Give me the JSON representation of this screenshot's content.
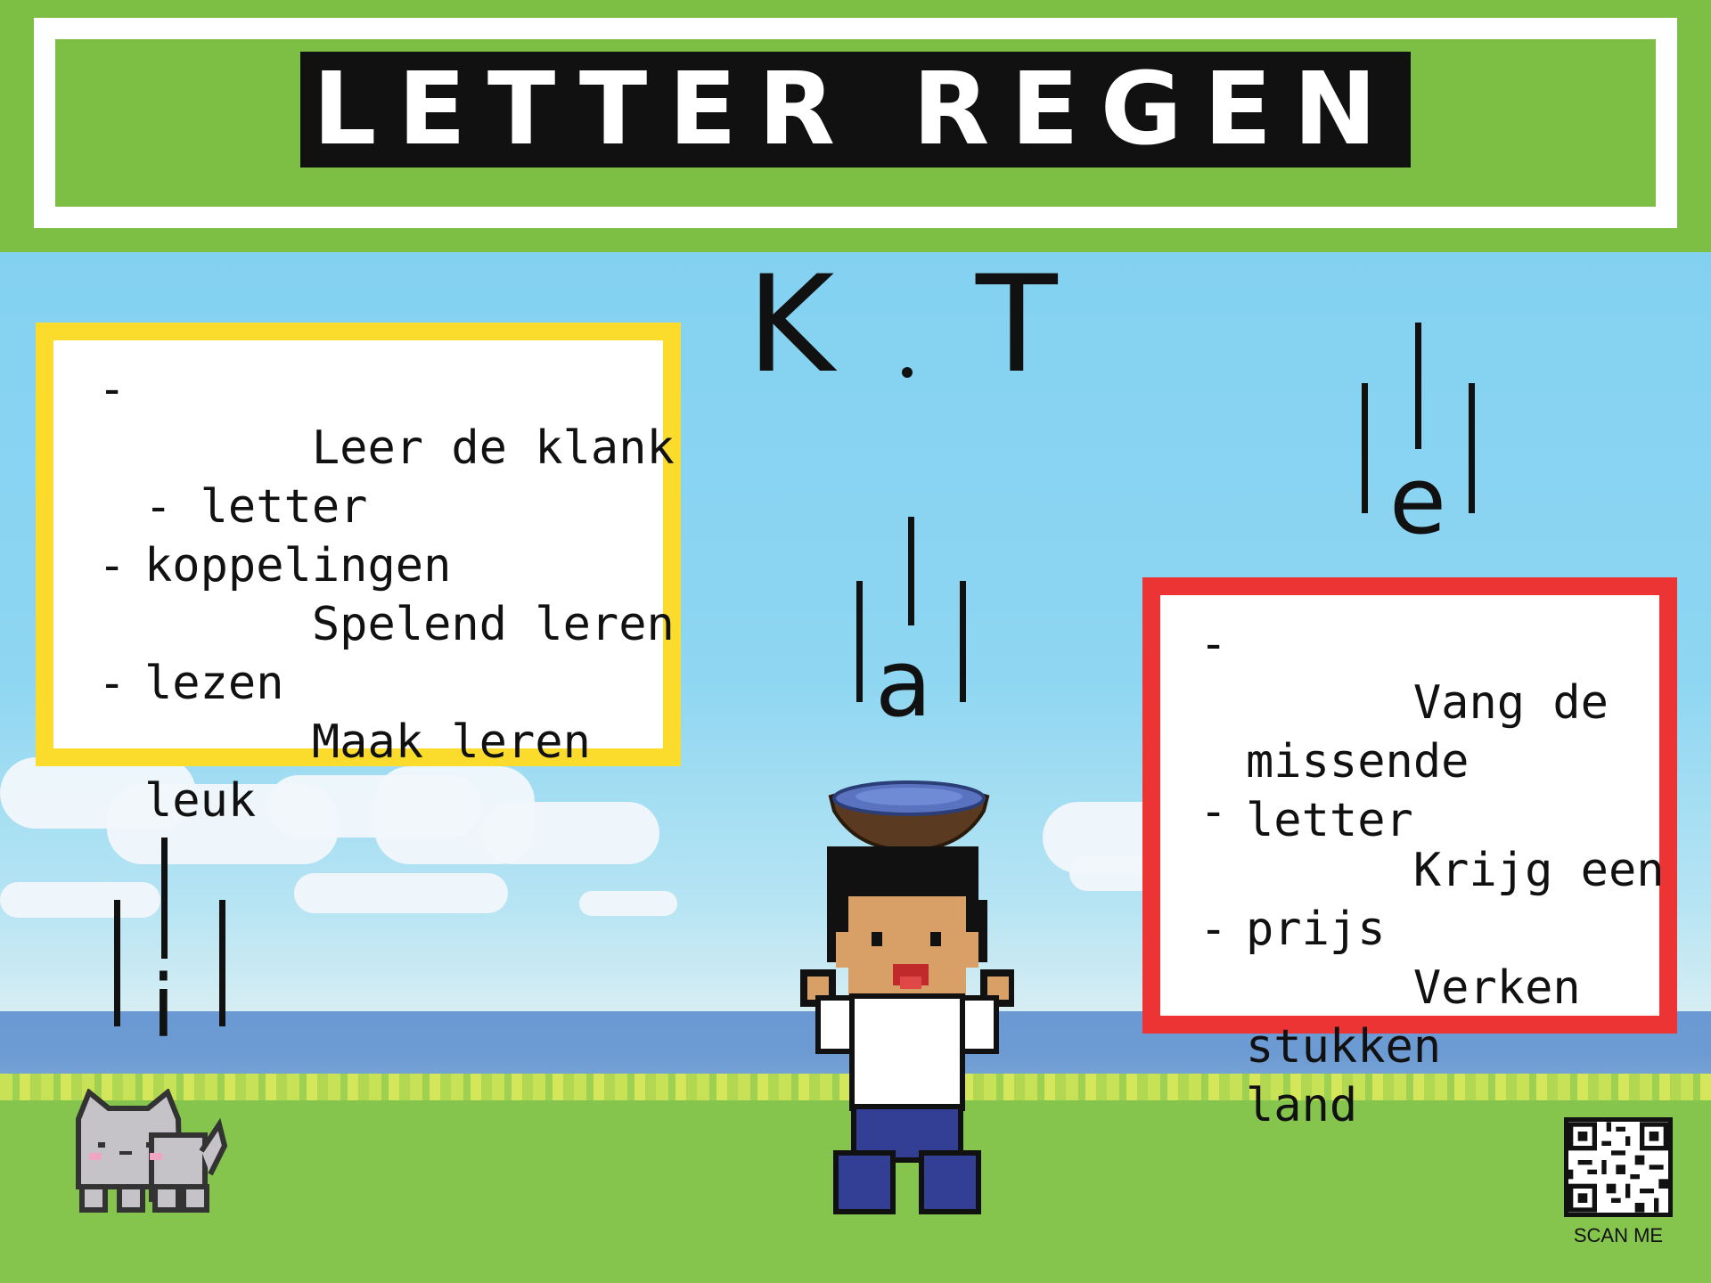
{
  "game": {
    "title": "LETTER REGEN"
  },
  "word_puzzle": {
    "first_letter": "K",
    "separator": ".",
    "last_letter": "T"
  },
  "left_panel": {
    "items": [
      {
        "dash": "-",
        "text": "Leer de klank - letter\nkoppelingen"
      },
      {
        "dash": "-",
        "text": "Spelend leren lezen"
      },
      {
        "dash": "-",
        "text": "Maak leren leuk"
      }
    ]
  },
  "right_panel": {
    "items": [
      {
        "dash": "-",
        "text": "Vang de missende\nletter"
      },
      {
        "dash": "-",
        "text": "Krijg een prijs"
      },
      {
        "dash": "-",
        "text": "Verken stukken\nland"
      }
    ]
  },
  "falling_letters": [
    "a",
    "e",
    "i"
  ],
  "qr": {
    "label": "SCAN ME"
  },
  "colors": {
    "header": "#7cbf44",
    "left_border": "#fbdc2c",
    "right_border": "#ec3434",
    "grass": "#86c54d",
    "sky": "#86d4f0"
  },
  "icons": [
    "bowl-icon",
    "player-character",
    "cat-character",
    "qr-code"
  ]
}
